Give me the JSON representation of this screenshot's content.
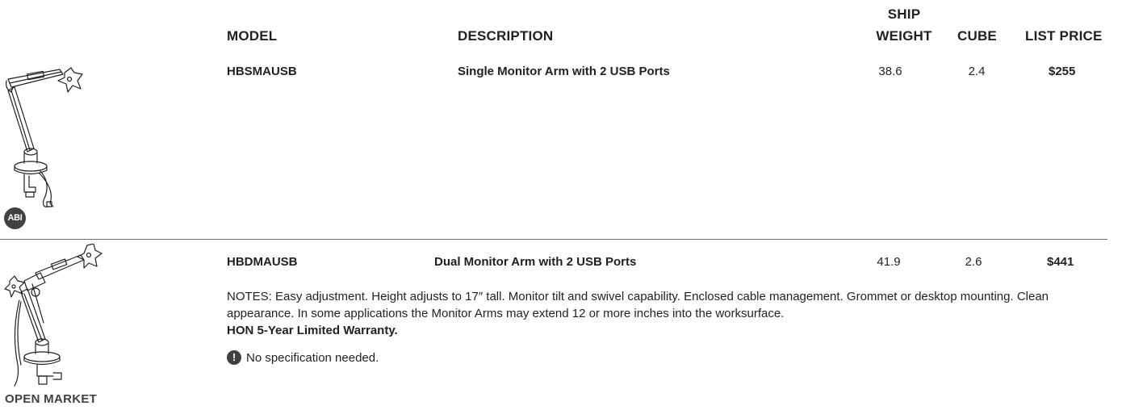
{
  "headers": {
    "model": "MODEL",
    "description": "DESCRIPTION",
    "ship_weight_line1": "SHIP",
    "ship_weight_line2": "WEIGHT",
    "cube": "CUBE",
    "list_price": "LIST PRICE"
  },
  "products": [
    {
      "model": "HBSMAUSB",
      "description": "Single Monitor Arm with 2 USB Ports",
      "ship_weight": "38.6",
      "cube": "2.4",
      "list_price": "$255",
      "badge": "ABI",
      "image_icon": "single-monitor-arm-illustration"
    },
    {
      "model": "HBDMAUSB",
      "description": "Dual Monitor Arm with 2 USB Ports",
      "ship_weight": "41.9",
      "cube": "2.6",
      "list_price": "$441",
      "badge": "OPEN MARKET",
      "image_icon": "dual-monitor-arm-illustration"
    }
  ],
  "notes": "NOTES: Easy adjustment. Height adjusts to 17″ tall. Monitor tilt and swivel capability. Enclosed cable management. Grommet or desktop mounting. Clean appearance. In some applications the Monitor Arms may extend 12 or more inches into the worksurface.",
  "warranty": "HON 5-Year Limited Warranty.",
  "spec_icon": "!",
  "spec_note": "No specification needed.",
  "colors": {
    "text": "#231f20",
    "badge": "#414042",
    "divider": "#6d6e71"
  }
}
